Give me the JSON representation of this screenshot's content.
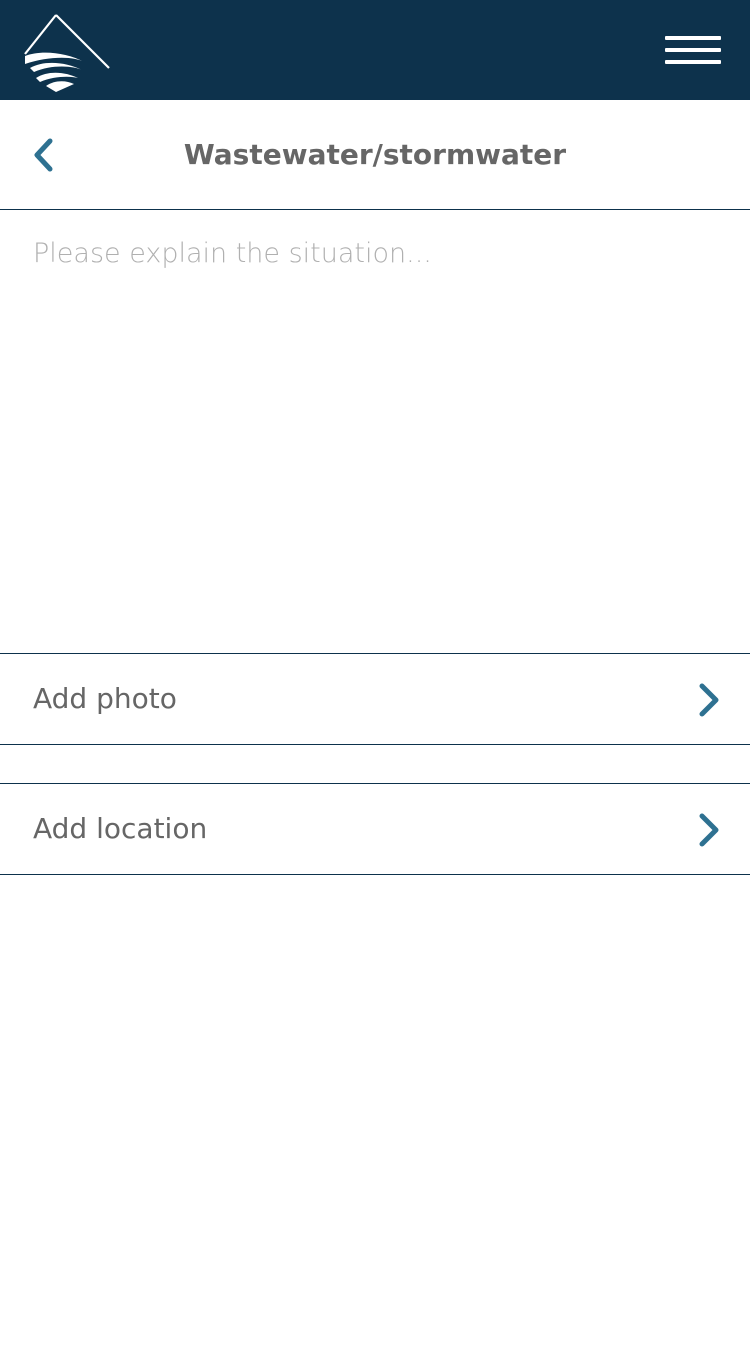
{
  "header": {
    "logo_icon": "mountain-water-logo-icon",
    "menu_icon": "hamburger-menu-icon",
    "background_color": "#0d324c"
  },
  "subheader": {
    "back_icon": "chevron-left-icon",
    "title": "Wastewater/stormwater"
  },
  "description": {
    "placeholder": "Please explain the situation...",
    "value": ""
  },
  "actions": [
    {
      "label": "Add photo",
      "icon": "chevron-right-icon"
    },
    {
      "label": "Add location",
      "icon": "chevron-right-icon"
    }
  ],
  "colors": {
    "accent": "#2e7191",
    "text": "#666666",
    "placeholder": "#b0b0b0",
    "divider": "#0d324c"
  }
}
